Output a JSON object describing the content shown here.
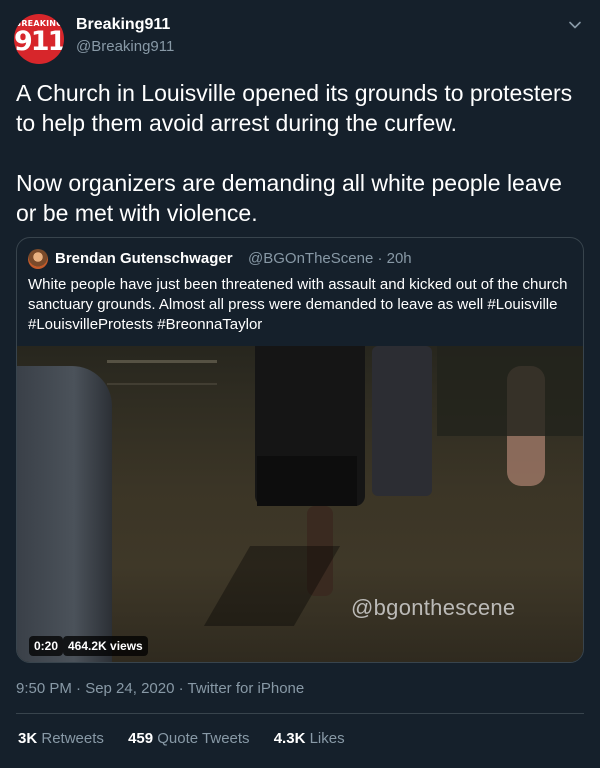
{
  "author": {
    "avatar_text_top": "BREAKING",
    "avatar_text_main": "911",
    "display_name": "Breaking911",
    "handle": "@Breaking911"
  },
  "tweet": {
    "paragraphs": [
      "A Church in Louisville opened its grounds to protesters to help them avoid arrest during the curfew.",
      "Now organizers are demanding all white people leave or be met with violence."
    ]
  },
  "quoted": {
    "display_name": "Brendan Gutenschwager",
    "handle_time": "@BGOnTheScene · 20h",
    "text": "White people have just been threatened with assault and kicked out of the church sanctuary grounds. Almost all press were demanded to leave as well #Louisville #LouisvilleProtests #BreonnaTaylor",
    "video": {
      "watermark": "@bgonthescene",
      "duration": "0:20",
      "views": "464.2K views"
    }
  },
  "meta": {
    "timestamp": "9:50 PM · Sep 24, 2020 · Twitter for iPhone"
  },
  "stats": {
    "retweets_count": "3K",
    "retweets_label": "Retweets",
    "quotes_count": "459",
    "quotes_label": "Quote Tweets",
    "likes_count": "4.3K",
    "likes_label": "Likes"
  },
  "colors": {
    "background": "#15202b",
    "secondary_text": "#8899a6",
    "border": "#38444d",
    "avatar_red": "#d7262b"
  }
}
